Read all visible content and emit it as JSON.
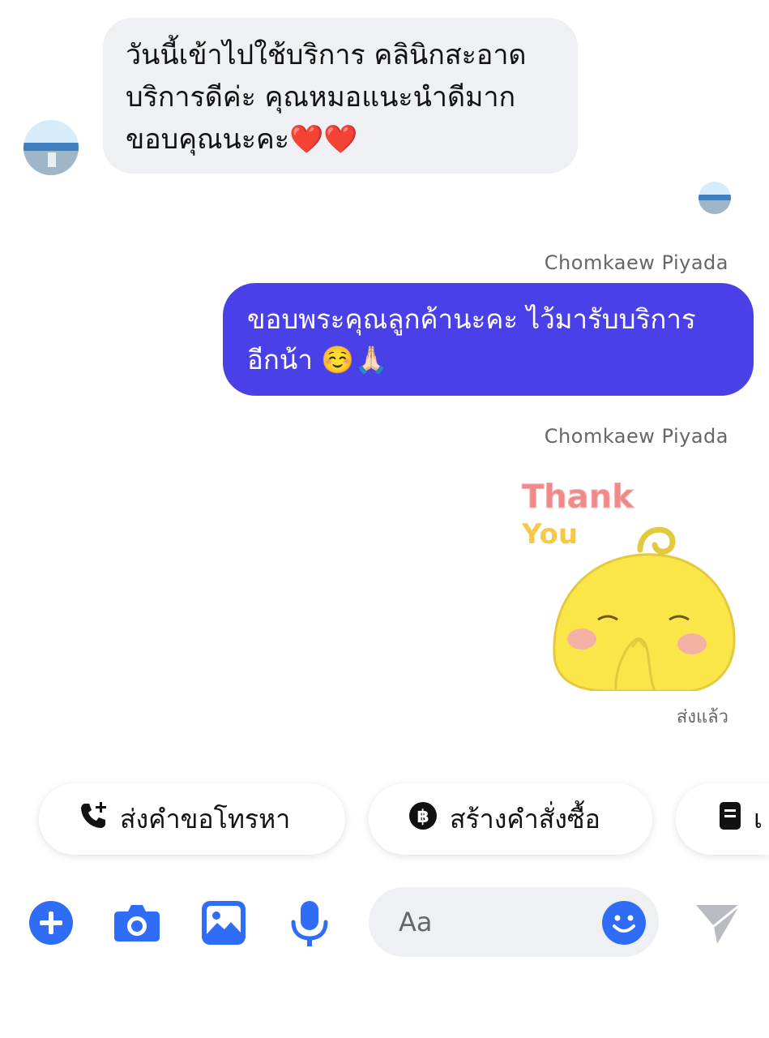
{
  "conversation": {
    "incoming": {
      "lines": [
        "วันนี้เข้าไปใช้บริการ คลินิกสะอาด",
        "บริการดีค่ะ คุณหมอแนะนำดีมาก",
        "ขอบคุณนะคะ❤️❤️"
      ]
    },
    "outgoing_sender_1": "Chomkaew Piyada",
    "outgoing_message": {
      "lines": [
        "ขอบพระคุณลูกค้านะคะ ไว้มารับบริการ",
        "อีกน้า ☺️🙏🏻"
      ]
    },
    "outgoing_sender_2": "Chomkaew Piyada",
    "sticker": {
      "line1": "Thank",
      "line2": "You"
    },
    "status": "ส่งแล้ว"
  },
  "quick_actions": [
    {
      "label": "ส่งคำขอโทรหา",
      "icon": "phone-add-icon"
    },
    {
      "label": "สร้างคำสั่งซื้อ",
      "icon": "baht-coin-icon"
    },
    {
      "label": "เ",
      "icon": "document-icon"
    }
  ],
  "composer": {
    "placeholder": "Aa",
    "tools": [
      "plus-icon",
      "camera-icon",
      "gallery-icon",
      "microphone-icon",
      "emoji-icon",
      "send-icon"
    ]
  },
  "colors": {
    "accent": "#2f6df6",
    "outgoing_bubble": "#4a40e8",
    "incoming_bubble": "#eef0f3"
  }
}
